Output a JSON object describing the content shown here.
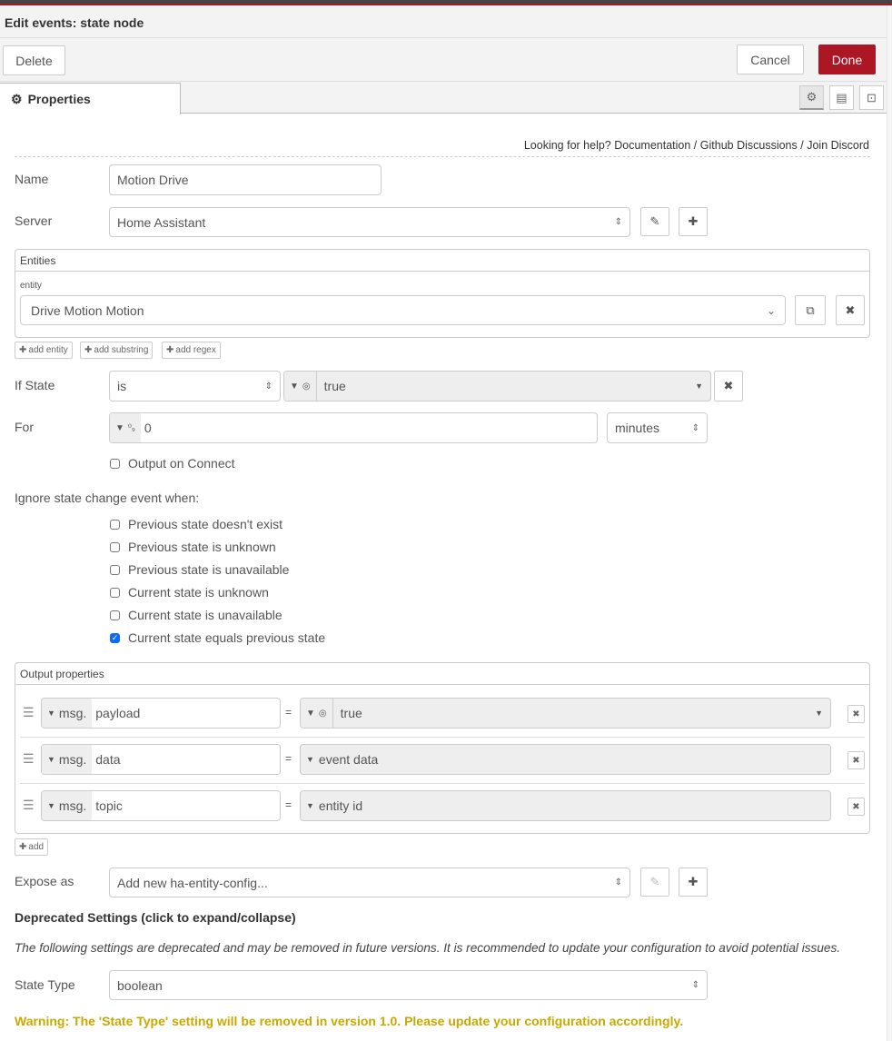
{
  "header": {
    "title": "Edit events: state node",
    "delete_label": "Delete",
    "cancel_label": "Cancel",
    "done_label": "Done"
  },
  "tabs": {
    "properties_label": "Properties"
  },
  "help": {
    "prefix": "Looking for help?",
    "documentation": "Documentation",
    "sep1": "/",
    "github": "Github Discussions",
    "sep2": "/",
    "discord": "Join Discord"
  },
  "form": {
    "name_label": "Name",
    "name_value": "Motion Drive",
    "server_label": "Server",
    "server_value": "Home Assistant",
    "entities": {
      "header": "Entities",
      "entity_label": "entity",
      "entity_value": "Drive Motion Motion",
      "add_entity": "add entity",
      "add_substring": "add substring",
      "add_regex": "add regex"
    },
    "if_state_label": "If State",
    "if_state_op": "is",
    "if_state_value": "true",
    "for_label": "For",
    "for_value": "0",
    "for_units": "minutes",
    "output_on_connect": "Output on Connect",
    "ignore_heading": "Ignore state change event when:",
    "ignore_options": [
      {
        "label": "Previous state doesn't exist",
        "checked": false
      },
      {
        "label": "Previous state is unknown",
        "checked": false
      },
      {
        "label": "Previous state is unavailable",
        "checked": false
      },
      {
        "label": "Current state is unknown",
        "checked": false
      },
      {
        "label": "Current state is unavailable",
        "checked": false
      },
      {
        "label": "Current state equals previous state",
        "checked": true
      }
    ],
    "output": {
      "header": "Output properties",
      "prefix": "msg.",
      "eq": "=",
      "rows": [
        {
          "property": "payload",
          "value": "true"
        },
        {
          "property": "data",
          "value": "event data"
        },
        {
          "property": "topic",
          "value": "entity id"
        }
      ],
      "add_label": "add"
    },
    "expose_label": "Expose as",
    "expose_value": "Add new ha-entity-config...",
    "deprecated_heading": "Deprecated Settings (click to expand/collapse)",
    "deprecated_text": "The following settings are deprecated and may be removed in future versions. It is recommended to update your configuration to avoid potential issues.",
    "state_type_label": "State Type",
    "state_type_value": "boolean",
    "warning": "Warning: The 'State Type' setting will be removed in version 1.0. Please update your configuration accordingly."
  },
  "colors": {
    "accent": "#ad1625",
    "warning": "#c9a800",
    "checkbox": "#0a6cff"
  }
}
